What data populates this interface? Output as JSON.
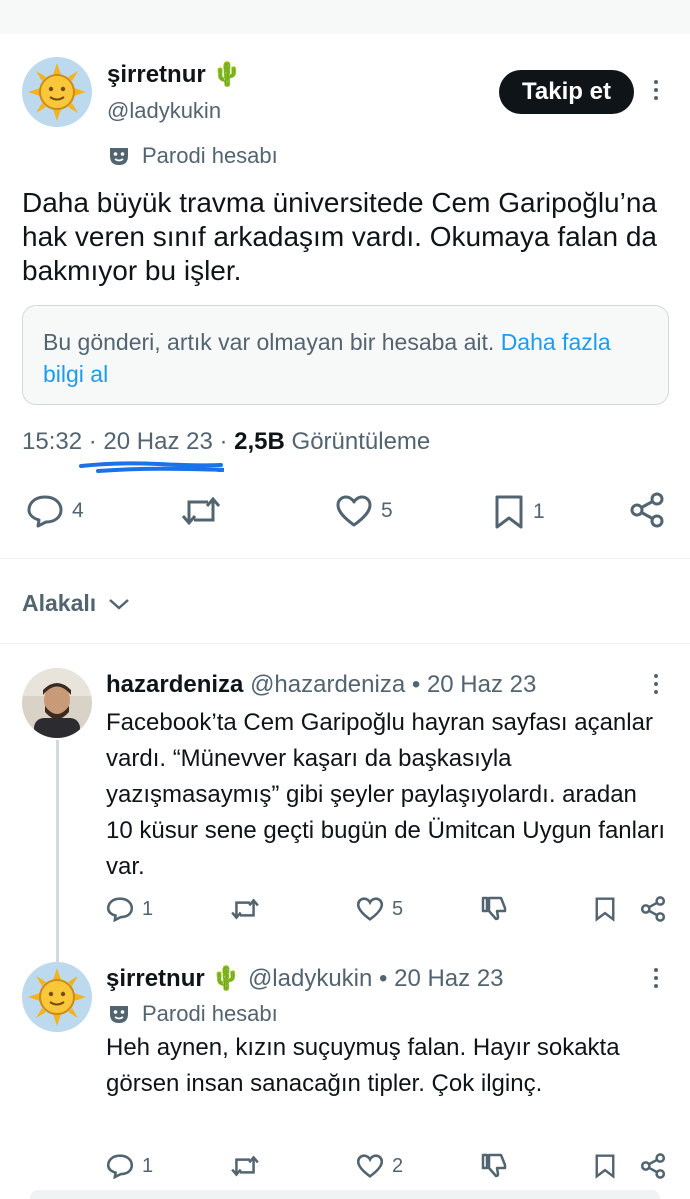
{
  "main_post": {
    "display_name": "şirretnur",
    "name_emoji": "🌵",
    "handle": "@ladykukin",
    "follow_label": "Takip et",
    "parody_label": "Parodi hesabı",
    "text": "Daha büyük travma üniversitede Cem Garipoğlu’na hak veren sınıf arkadaşım vardı. Okumaya falan da bakmıyor bu işler.",
    "notice_text": "Bu gönderi, artık var olmayan bir hesaba ait.",
    "notice_link": "Daha fazla bilgi al",
    "time": "15:32",
    "sep1": "·",
    "date": "20 Haz 23",
    "sep2": "·",
    "views_count": "2,5B",
    "views_label": "Görüntüleme",
    "replies": "4",
    "likes": "5",
    "bookmarks": "1"
  },
  "relevance_label": "Alakalı",
  "replies": [
    {
      "display_name": "hazardeniza",
      "handle": "@hazardeniza",
      "sep": "•",
      "date": "20 Haz 23",
      "text": "Facebook’ta Cem Garipoğlu hayran sayfası açanlar vardı. “Münevver kaşarı da başkasıyla yazışmasaymış” gibi şeyler paylaşıyolardı. aradan 10 küsur sene geçti bugün de Ümitcan Uygun fanları var.",
      "replies": "1",
      "likes": "5"
    },
    {
      "display_name": "şirretnur",
      "name_emoji": "🌵",
      "handle": "@ladykukin",
      "sep": "•",
      "date": "20 Haz 23",
      "parody_label": "Parodi hesabı",
      "text": "Heh aynen, kızın suçuymuş falan. Hayır sokakta görsen insan sanacağın tipler. Çok ilginç.",
      "replies": "1",
      "likes": "2"
    }
  ],
  "colors": {
    "text": "#0f1419",
    "secondary": "#536471",
    "link": "#1d9bf0",
    "underline_annotation": "#1a73e8",
    "border": "#cfd9de"
  }
}
